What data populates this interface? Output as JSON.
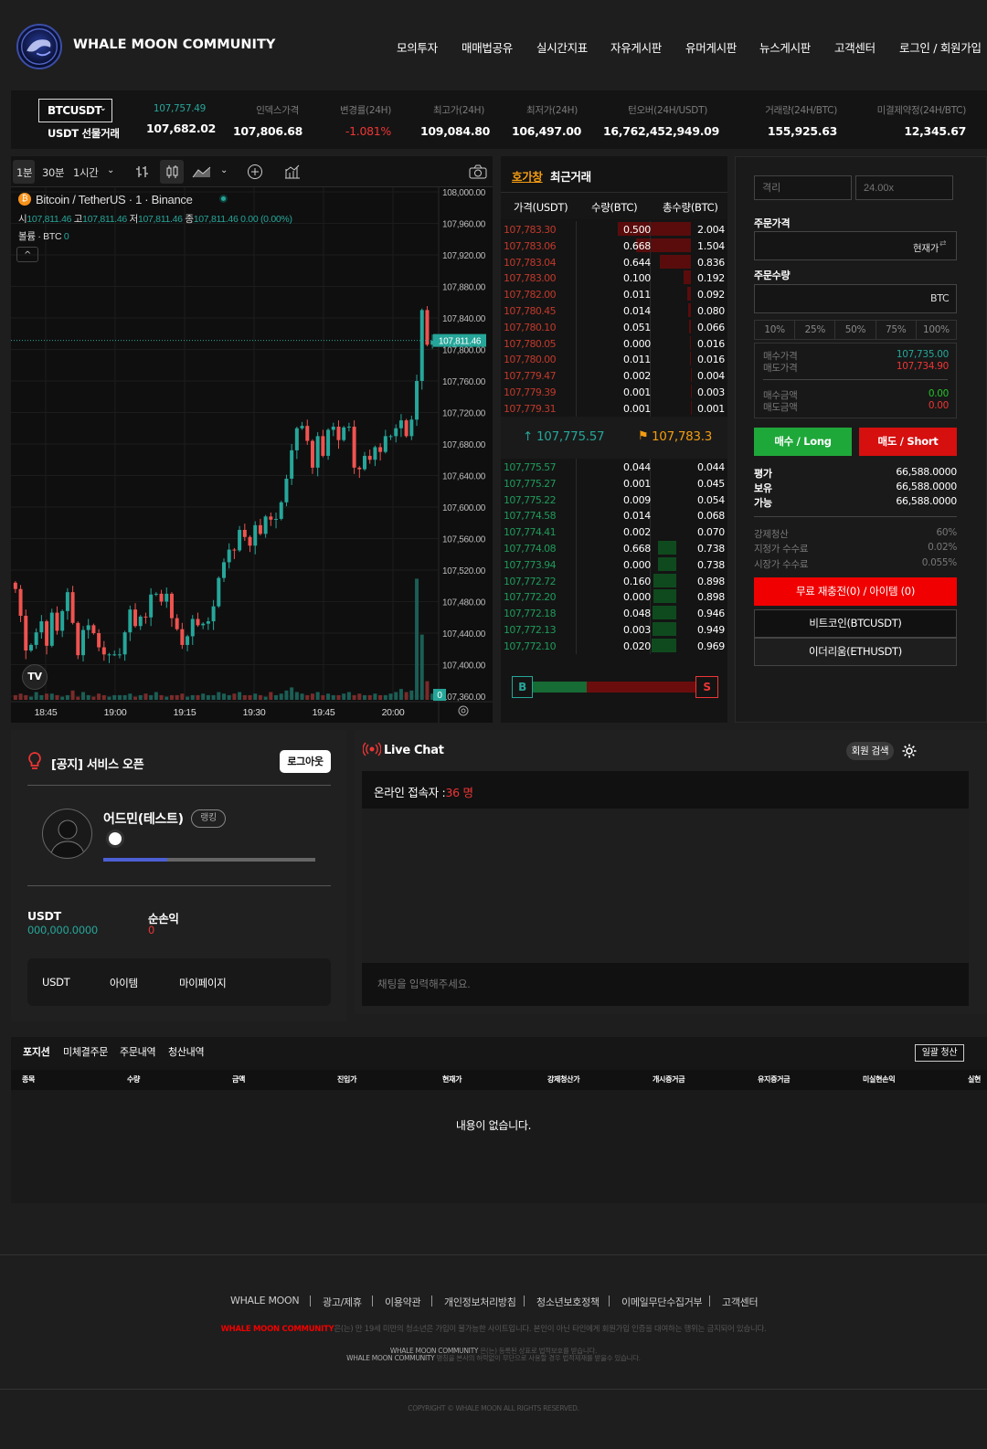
{
  "header": {
    "brand": "WHALE MOON COMMUNITY",
    "nav": [
      "모의투자",
      "매매법공유",
      "실시간지표",
      "자유게시판",
      "유머게시판",
      "뉴스게시판",
      "고객센터",
      "로그인 / 회원가입"
    ]
  },
  "ticker": {
    "symbol": "BTCUSDT",
    "symbol_caret": "⌄",
    "market": "USDT 선물거래",
    "last_small": "107,757.49",
    "last": "107,682.02",
    "items": [
      {
        "label": "인덱스가격",
        "value": "107,806.68"
      },
      {
        "label": "변경률(24H)",
        "value": "-1.081%"
      },
      {
        "label": "최고가(24H)",
        "value": "109,084.80"
      },
      {
        "label": "최저가(24H)",
        "value": "106,497.00"
      },
      {
        "label": "턴오버(24H/USDT)",
        "value": "16,762,452,949.09"
      },
      {
        "label": "거래량(24H/BTC)",
        "value": "155,925.63"
      },
      {
        "label": "미결제약정(24H/BTC)",
        "value": "12,345.67"
      }
    ]
  },
  "chart_toolbar": {
    "intervals": [
      "1분",
      "30분",
      "1시간"
    ],
    "caret": "⌄"
  },
  "chart": {
    "legend_title": "Bitcoin / TetherUS · 1 · Binance",
    "ohlc": {
      "o_label": "시",
      "o": "107,811.46",
      "h_label": "고",
      "h": "107,811.46",
      "l_label": "저",
      "l": "107,811.46",
      "c_label": "종",
      "c": "107,811.46",
      "chg": "0.00 (0.00%)"
    },
    "volume_label": "볼륨 · BTC",
    "volume_value": "0",
    "collapse": "^",
    "price_tag": "107,811.46",
    "vol_tag": "0",
    "tv_logo": "TV"
  },
  "chart_data": {
    "type": "candlestick",
    "y_ticks": [
      "108,000.00",
      "107,960.00",
      "107,920.00",
      "107,880.00",
      "107,840.00",
      "107,800.00",
      "107,760.00",
      "107,720.00",
      "107,680.00",
      "107,640.00",
      "107,600.00",
      "107,560.00",
      "107,520.00",
      "107,480.00",
      "107,440.00",
      "107,400.00",
      "107,360.00"
    ],
    "x_ticks": [
      "18:45",
      "19:00",
      "19:15",
      "19:30",
      "19:45",
      "20:00"
    ],
    "ylim": [
      107360,
      108000
    ],
    "last_price": 107811.46,
    "closes": [
      107496,
      107462,
      107418,
      107425,
      107441,
      107455,
      107424,
      107466,
      107443,
      107468,
      107492,
      107453,
      107412,
      107444,
      107450,
      107440,
      107422,
      107413,
      107413,
      107413,
      107413,
      107441,
      107470,
      107449,
      107461,
      107460,
      107489,
      107490,
      107480,
      107490,
      107459,
      107445,
      107425,
      107436,
      107458,
      107450,
      107452,
      107455,
      107474,
      107510,
      107530,
      107546,
      107545,
      107571,
      107562,
      107551,
      107577,
      107566,
      107588,
      107584,
      107585,
      107606,
      107636,
      107672,
      107700,
      107703,
      107684,
      107650,
      107690,
      107665,
      107698,
      107702,
      107685,
      107701,
      107702,
      107650,
      107648,
      107665,
      107660,
      107676,
      107670,
      107690,
      107690,
      107700,
      107710,
      107690,
      107711,
      107760,
      107850,
      107806,
      107811
    ],
    "volumes": [
      3,
      4,
      3,
      2,
      5,
      3,
      4,
      4,
      3,
      2,
      3,
      6,
      2,
      5,
      3,
      2,
      4,
      3,
      2,
      3,
      3,
      3,
      4,
      2,
      3,
      4,
      3,
      5,
      3,
      2,
      3,
      3,
      4,
      2,
      3,
      3,
      4,
      3,
      3,
      5,
      4,
      3,
      4,
      5,
      3,
      3,
      4,
      3,
      2,
      5,
      3,
      4,
      6,
      8,
      5,
      4,
      3,
      4,
      5,
      3,
      4,
      3,
      3,
      4,
      5,
      3,
      4,
      3,
      3,
      4,
      3,
      3,
      4,
      5,
      7,
      5,
      6,
      78,
      42,
      12,
      4
    ]
  },
  "orderbook": {
    "tab_active": "호가창",
    "tab_other": "최근거래",
    "headers": [
      "가격(USDT)",
      "수량(BTC)",
      "총수량(BTC)"
    ],
    "asks": [
      {
        "p": "107,783.30",
        "q": "0.500",
        "t": "2.004",
        "d": 1.0
      },
      {
        "p": "107,783.06",
        "q": "0.668",
        "t": "1.504",
        "d": 0.75
      },
      {
        "p": "107,783.04",
        "q": "0.644",
        "t": "0.836",
        "d": 0.42
      },
      {
        "p": "107,783.00",
        "q": "0.100",
        "t": "0.192",
        "d": 0.1
      },
      {
        "p": "107,782.00",
        "q": "0.011",
        "t": "0.092",
        "d": 0.05
      },
      {
        "p": "107,780.45",
        "q": "0.014",
        "t": "0.080",
        "d": 0.04
      },
      {
        "p": "107,780.10",
        "q": "0.051",
        "t": "0.066",
        "d": 0.03
      },
      {
        "p": "107,780.05",
        "q": "0.000",
        "t": "0.016",
        "d": 0.01
      },
      {
        "p": "107,780.00",
        "q": "0.011",
        "t": "0.016",
        "d": 0.01
      },
      {
        "p": "107,779.47",
        "q": "0.002",
        "t": "0.004",
        "d": 0.005
      },
      {
        "p": "107,779.39",
        "q": "0.001",
        "t": "0.003",
        "d": 0.003
      },
      {
        "p": "107,779.31",
        "q": "0.001",
        "t": "0.001",
        "d": 0.001
      }
    ],
    "mid_up": "↑ 107,775.57",
    "mid_flag": "107,783.3",
    "bids": [
      {
        "p": "107,775.57",
        "q": "0.044",
        "t": "0.044",
        "d": 0.0
      },
      {
        "p": "107,775.27",
        "q": "0.001",
        "t": "0.045",
        "d": 0.0
      },
      {
        "p": "107,775.22",
        "q": "0.009",
        "t": "0.054",
        "d": 0.0
      },
      {
        "p": "107,774.58",
        "q": "0.014",
        "t": "0.068",
        "d": 0.0
      },
      {
        "p": "107,774.41",
        "q": "0.002",
        "t": "0.070",
        "d": 0.0
      },
      {
        "p": "107,774.08",
        "q": "0.668",
        "t": "0.738",
        "d": 0.76
      },
      {
        "p": "107,773.94",
        "q": "0.000",
        "t": "0.738",
        "d": 0.76
      },
      {
        "p": "107,772.72",
        "q": "0.160",
        "t": "0.898",
        "d": 0.93
      },
      {
        "p": "107,772.20",
        "q": "0.000",
        "t": "0.898",
        "d": 0.93
      },
      {
        "p": "107,772.18",
        "q": "0.048",
        "t": "0.946",
        "d": 0.98
      },
      {
        "p": "107,772.13",
        "q": "0.003",
        "t": "0.949",
        "d": 0.98
      },
      {
        "p": "107,772.10",
        "q": "0.020",
        "t": "0.969",
        "d": 1.0
      }
    ],
    "b_label": "B",
    "s_label": "S",
    "buy_ratio": 0.33
  },
  "order": {
    "margin_placeholder": "격리",
    "leverage_placeholder": "24.00x",
    "price_label": "주문가격",
    "price_suffix": "현재가",
    "qty_label": "주문수량",
    "qty_suffix": "BTC",
    "pcts": [
      "10%",
      "25%",
      "50%",
      "75%",
      "100%"
    ],
    "buy_price_label": "매수가격",
    "sell_price_label": "매도가격",
    "buy_price": "107,735.00",
    "sell_price": "107,734.90",
    "buy_amt_label": "매수금액",
    "sell_amt_label": "매도금액",
    "buy_amt": "0.00",
    "sell_amt": "0.00",
    "long_btn": "매수 / Long",
    "short_btn": "매도 / Short",
    "bal": [
      {
        "l": "평가",
        "v": "66,588.0000"
      },
      {
        "l": "보유",
        "v": "66,588.0000"
      },
      {
        "l": "가능",
        "v": "66,588.0000"
      }
    ],
    "fees": [
      {
        "l": "강제청산",
        "v": "60%"
      },
      {
        "l": "지정가 수수료",
        "v": "0.02%"
      },
      {
        "l": "시장가 수수료",
        "v": "0.055%"
      }
    ],
    "recharge_btn": "무료 재충전(0) / 아이템 (0)",
    "coin1": "비트코인(BTCUSDT)",
    "coin2": "이더리움(ETHUSDT)"
  },
  "profile": {
    "notice": "[공지] 서비스 오픈",
    "logout": "로그아웃",
    "name": "어드민(테스트)",
    "rank": "랭킹",
    "progress": 0.3,
    "usdt_label": "USDT",
    "usdt_value": "000,000.0000",
    "pnl_label": "순손익",
    "pnl_value": "0",
    "tabs": [
      "USDT",
      "아이템",
      "마이페이지"
    ]
  },
  "chat": {
    "title": "Live Chat",
    "search": "회원 검색",
    "online_label": "온라인 접속자 :",
    "online_count": "36 명",
    "placeholder": "채팅을 입력해주세요."
  },
  "positions": {
    "tabs": [
      "포지션",
      "미체결주문",
      "주문내역",
      "청산내역"
    ],
    "close_all": "일괄 청산",
    "columns": [
      "종목",
      "수량",
      "금액",
      "진입가",
      "현재가",
      "강제청산가",
      "개시증거금",
      "유지증거금",
      "미실현손익",
      "실현"
    ],
    "empty": "내용이 없습니다."
  },
  "footer": {
    "links": [
      "WHALE MOON",
      "광고/제휴",
      "이용약관",
      "개인정보처리방침",
      "청소년보호정책",
      "이메일무단수집거부",
      "고객센터"
    ],
    "notice_brand": "WHALE MOON COMMUNITY",
    "notice_text": "은(는) 만 19세 미만의 청소년은 가입이 불가능한 사이트입니다. 본인이 아닌 타인에게 회원가입 인증을 대여하는 행위는 금지되어 있습니다.",
    "line1_brand": "WHALE MOON COMMUNITY",
    "line1_text": "은(는) 등록된 상표로 법적보호를 받습니다.",
    "line2_brand": "WHALE MOON COMMUNITY",
    "line2_text": "명칭을 본사의 허락없이 무단으로 사용할 경우 법적제재를 받을수 있습니다.",
    "copyright": "COPYRIGHT © WHALE MOON ALL RIGHTS RESERVED."
  },
  "colors": {
    "up": "#26a69a",
    "down": "#ef5350",
    "accent_red": "#f00000",
    "green_btn": "#1fa83a",
    "red_btn": "#d60f0f",
    "orange": "#f39c12"
  }
}
